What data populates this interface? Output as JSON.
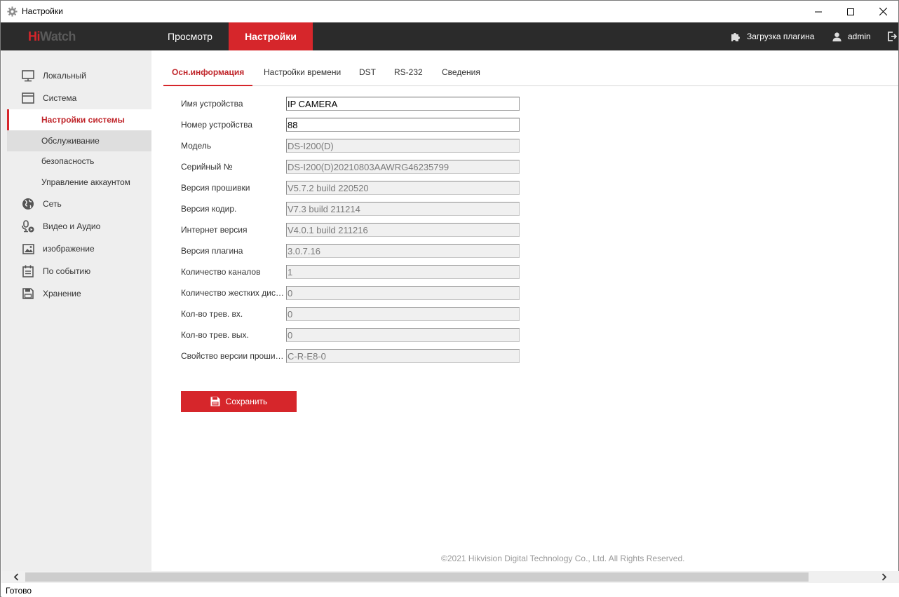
{
  "window": {
    "title": "Настройки"
  },
  "brand": {
    "hi": "Hi",
    "watch": "Watch"
  },
  "topnav": {
    "view": "Просмотр",
    "settings": "Настройки",
    "plugin": "Загрузка плагина",
    "user": "admin"
  },
  "sidebar": {
    "local": "Локальный",
    "system": "Система",
    "system_settings": "Настройки системы",
    "maintenance": "Обслуживание",
    "security": "безопасность",
    "accounts": "Управление аккаунтом",
    "network": "Сеть",
    "video_audio": "Видео и Аудио",
    "image": "изображение",
    "event": "По событию",
    "storage": "Хранение"
  },
  "tabs": {
    "basic": "Осн.информация",
    "time": "Настройки времени",
    "dst": "DST",
    "rs232": "RS-232",
    "about": "Сведения"
  },
  "form": {
    "rows": [
      {
        "label": "Имя устройства",
        "value": "IP CAMERA",
        "readonly": false
      },
      {
        "label": "Номер устройства",
        "value": "88",
        "readonly": false
      },
      {
        "label": "Модель",
        "value": "DS-I200(D)",
        "readonly": true
      },
      {
        "label": "Серийный №",
        "value": "DS-I200(D)20210803AAWRG46235799",
        "readonly": true
      },
      {
        "label": "Версия прошивки",
        "value": "V5.7.2 build 220520",
        "readonly": true
      },
      {
        "label": "Версия кодир.",
        "value": "V7.3 build 211214",
        "readonly": true
      },
      {
        "label": "Интернет версия",
        "value": "V4.0.1 build 211216",
        "readonly": true
      },
      {
        "label": "Версия плагина",
        "value": "3.0.7.16",
        "readonly": true
      },
      {
        "label": "Количество каналов",
        "value": "1",
        "readonly": true
      },
      {
        "label": "Количество жестких дисков",
        "value": "0",
        "readonly": true
      },
      {
        "label": "Кол-во трев. вх.",
        "value": "0",
        "readonly": true
      },
      {
        "label": "Кол-во трев. вых.",
        "value": "0",
        "readonly": true
      },
      {
        "label": "Свойство версии прошивки",
        "value": "C-R-E8-0",
        "readonly": true
      }
    ],
    "save": "Сохранить"
  },
  "footer": {
    "copyright": "©2021 Hikvision Digital Technology Co., Ltd. All Rights Reserved."
  },
  "status": {
    "text": "Готово"
  },
  "colors": {
    "accent": "#d6262b",
    "topbar": "#2b2b2b",
    "sidebar": "#eeeeee"
  }
}
